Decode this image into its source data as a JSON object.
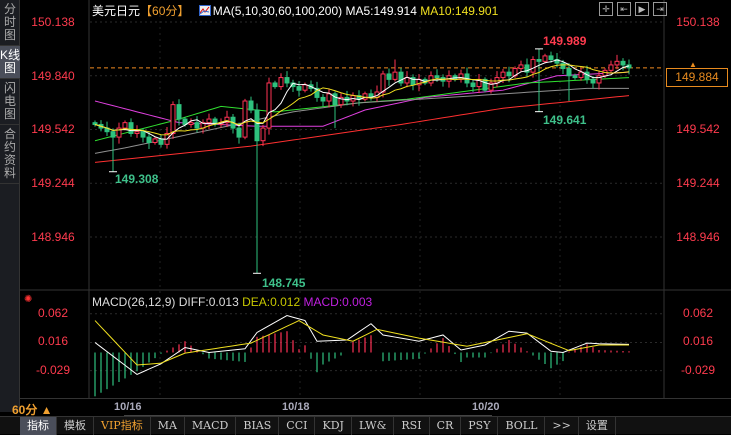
{
  "sidebar": {
    "tabs": [
      {
        "label": "分时图"
      },
      {
        "label": "K线图"
      },
      {
        "label": "闪电图"
      },
      {
        "label": "合约资料"
      }
    ]
  },
  "header": {
    "symbol": "美元日元",
    "period_tag": "【60分】",
    "ma_params": "MA(5,10,30,60,100,200)",
    "ma5": "MA5:149.914",
    "ma10": "MA10:149.901"
  },
  "toolbar": {
    "icons": [
      "crosshair-icon",
      "zoom-to-start-icon",
      "play-forward-icon",
      "scroll-to-end-icon"
    ]
  },
  "price_axis": {
    "labels": [
      "150.138",
      "149.840",
      "149.542",
      "149.244",
      "148.946"
    ],
    "current": "149.884"
  },
  "annotations": {
    "high": "149.989",
    "low_spike": "148.745",
    "low_left": "149.308",
    "low_right": "149.641"
  },
  "macd": {
    "title": "MACD(26,12,9)",
    "diff": "DIFF:0.013",
    "dea": "DEA:0.012",
    "macd": "MACD:0.003",
    "axis_labels": [
      "0.062",
      "0.016",
      "-0.029"
    ]
  },
  "dates": [
    "10/16",
    "10/18",
    "10/20"
  ],
  "period": "60分 ▲",
  "tabs": [
    "指标",
    "模板",
    "VIP指标",
    "MA",
    "MACD",
    "BIAS",
    "CCI",
    "KDJ",
    "LW&",
    "RSI",
    "CR",
    "PSY",
    "BOLL",
    ">>",
    "设置"
  ],
  "colors": {
    "up": "#ff3355",
    "down": "#2ec27e",
    "ma5": "#ffffff",
    "ma10": "#f0e020",
    "ma30": "#e040e0",
    "ma60": "#30e030",
    "ma100": "#909090",
    "ma200": "#ff3030",
    "current": "#f08a20"
  },
  "chart_data": {
    "type": "candlestick",
    "ylim": [
      148.7,
      150.16
    ],
    "first_open": 149.58,
    "close": [
      149.57,
      149.55,
      149.53,
      149.5,
      149.55,
      149.58,
      149.52,
      149.53,
      149.5,
      149.47,
      149.49,
      149.46,
      149.52,
      149.68,
      149.6,
      149.57,
      149.58,
      149.55,
      149.58,
      149.6,
      149.57,
      149.58,
      149.61,
      149.55,
      149.5,
      149.7,
      149.65,
      149.48,
      149.55,
      149.8,
      149.78,
      149.83,
      149.8,
      149.78,
      149.76,
      149.79,
      149.77,
      149.72,
      149.7,
      149.74,
      149.68,
      149.72,
      149.7,
      149.73,
      149.71,
      149.74,
      149.72,
      149.75,
      149.85,
      149.82,
      149.86,
      149.8,
      149.83,
      149.79,
      149.82,
      149.8,
      149.84,
      149.83,
      149.81,
      149.84,
      149.82,
      149.85,
      149.8,
      149.78,
      149.82,
      149.76,
      149.8,
      149.83,
      149.86,
      149.84,
      149.88,
      149.9,
      149.86,
      149.93,
      149.92,
      149.95,
      149.93,
      149.91,
      149.88,
      149.84,
      149.83,
      149.86,
      149.82,
      149.8,
      149.84,
      149.87,
      149.9,
      149.92,
      149.9,
      149.884
    ],
    "wick_overrides": [
      {
        "i": 3,
        "low": 149.308
      },
      {
        "i": 27,
        "low": 148.745
      },
      {
        "i": 40,
        "low": 149.55
      },
      {
        "i": 50,
        "high": 149.93
      },
      {
        "i": 74,
        "high": 149.989,
        "low": 149.641
      },
      {
        "i": 79,
        "low": 149.7
      }
    ],
    "ma_long": {
      "ma30": [
        [
          0,
          149.7
        ],
        [
          14,
          149.58
        ],
        [
          27,
          149.56
        ],
        [
          38,
          149.56
        ],
        [
          45,
          149.65
        ],
        [
          55,
          149.72
        ],
        [
          68,
          149.76
        ],
        [
          77,
          149.84
        ],
        [
          89,
          149.86
        ]
      ],
      "ma60": [
        [
          0,
          149.48
        ],
        [
          13,
          149.59
        ],
        [
          21,
          149.67
        ],
        [
          30,
          149.64
        ],
        [
          44,
          149.69
        ],
        [
          52,
          149.71
        ],
        [
          72,
          149.8
        ],
        [
          89,
          149.83
        ]
      ],
      "ma100": [
        [
          0,
          149.41
        ],
        [
          5,
          149.44
        ],
        [
          22,
          149.56
        ],
        [
          33,
          149.64
        ],
        [
          44,
          149.69
        ],
        [
          59,
          149.72
        ],
        [
          82,
          149.77
        ],
        [
          89,
          149.77
        ]
      ],
      "ma200": [
        [
          0,
          149.36
        ],
        [
          26,
          149.45
        ],
        [
          51,
          149.57
        ],
        [
          68,
          149.66
        ],
        [
          89,
          149.73
        ]
      ]
    },
    "macd_points": {
      "diff": [
        [
          0,
          0.016
        ],
        [
          7,
          -0.035
        ],
        [
          11,
          -0.018
        ],
        [
          15,
          0.008
        ],
        [
          19,
          0.0
        ],
        [
          25,
          0.006
        ],
        [
          27,
          0.032
        ],
        [
          32,
          0.059
        ],
        [
          35,
          0.051
        ],
        [
          37,
          0.018
        ],
        [
          42,
          0.02
        ],
        [
          46,
          0.046
        ],
        [
          48,
          0.028
        ],
        [
          54,
          0.018
        ],
        [
          58,
          0.028
        ],
        [
          61,
          0.004
        ],
        [
          65,
          0.012
        ],
        [
          69,
          0.034
        ],
        [
          72,
          0.031
        ],
        [
          76,
          0.002
        ],
        [
          78,
          0.0
        ],
        [
          82,
          0.015
        ],
        [
          84,
          0.014
        ],
        [
          89,
          0.013
        ]
      ],
      "dea": [
        [
          0,
          0.051
        ],
        [
          7,
          -0.02
        ],
        [
          11,
          -0.017
        ],
        [
          15,
          -0.001
        ],
        [
          26,
          0.015
        ],
        [
          34,
          0.051
        ],
        [
          38,
          0.028
        ],
        [
          43,
          0.018
        ],
        [
          47,
          0.037
        ],
        [
          54,
          0.023
        ],
        [
          62,
          0.01
        ],
        [
          72,
          0.03
        ],
        [
          79,
          0.003
        ],
        [
          84,
          0.012
        ],
        [
          89,
          0.012
        ]
      ]
    },
    "macd_ylim": [
      -0.075,
      0.075
    ]
  }
}
